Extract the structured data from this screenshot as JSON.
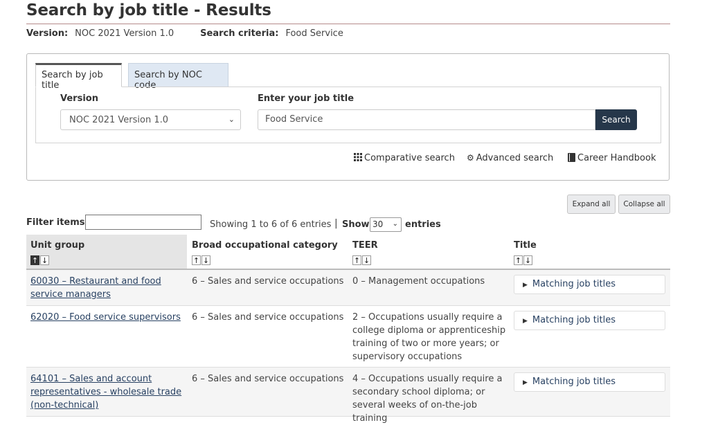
{
  "page": {
    "title": "Search by job title - Results",
    "version_label": "Version:",
    "version_value": "NOC 2021 Version 1.0",
    "criteria_label": "Search criteria:",
    "criteria_value": "Food Service"
  },
  "search_panel": {
    "tabs": [
      {
        "label": "Search by job title",
        "active": true
      },
      {
        "label": "Search by NOC code",
        "active": false
      }
    ],
    "version_field_label": "Version",
    "version_selected": "NOC 2021 Version 1.0",
    "job_title_field_label": "Enter your job title",
    "job_title_value": "Food Service",
    "search_button": "Search",
    "links": [
      {
        "label": "Comparative search",
        "icon": "grid-icon"
      },
      {
        "label": "Advanced search",
        "icon": "gear-icon"
      },
      {
        "label": "Career Handbook",
        "icon": "book-icon"
      }
    ]
  },
  "table_controls": {
    "expand_all": "Expand all",
    "collapse_all": "Collapse all",
    "filter_label": "Filter items",
    "filter_value": "",
    "showing": "Showing 1 to 6 of 6 entries",
    "show_label": "Show",
    "entries_value": "30",
    "entries_label": "entries"
  },
  "table": {
    "columns": [
      {
        "label": "Unit group",
        "sorted": "asc"
      },
      {
        "label": "Broad occupational category"
      },
      {
        "label": "TEER"
      },
      {
        "label": "Title"
      }
    ],
    "rows": [
      {
        "unit_group_line1": "60030 – Restaurant and food",
        "unit_group_line2": "service managers",
        "unit_group_line3": "",
        "category": "6 – Sales and service occupations",
        "teer": [
          "0 – Management occupations"
        ],
        "title_button": "Matching job titles"
      },
      {
        "unit_group_line1": "62020 – Food service supervisors",
        "unit_group_line2": "",
        "unit_group_line3": "",
        "category": "6 – Sales and service occupations",
        "teer": [
          "2 – Occupations usually require a",
          "college diploma or apprenticeship",
          "training of two or more years; or",
          "supervisory occupations"
        ],
        "title_button": "Matching job titles"
      },
      {
        "unit_group_line1": "64101 – Sales and account",
        "unit_group_line2": "representatives - wholesale trade",
        "unit_group_line3": "(non-technical)",
        "category": "6 – Sales and service occupations",
        "teer": [
          "4 – Occupations usually require a",
          "secondary school diploma; or",
          "several weeks of on-the-job training"
        ],
        "title_button": "Matching job titles"
      }
    ]
  },
  "colors": {
    "search_button_bg": "#26374a",
    "link": "#284162",
    "inactive_tab_bg": "#dfe8f3"
  }
}
